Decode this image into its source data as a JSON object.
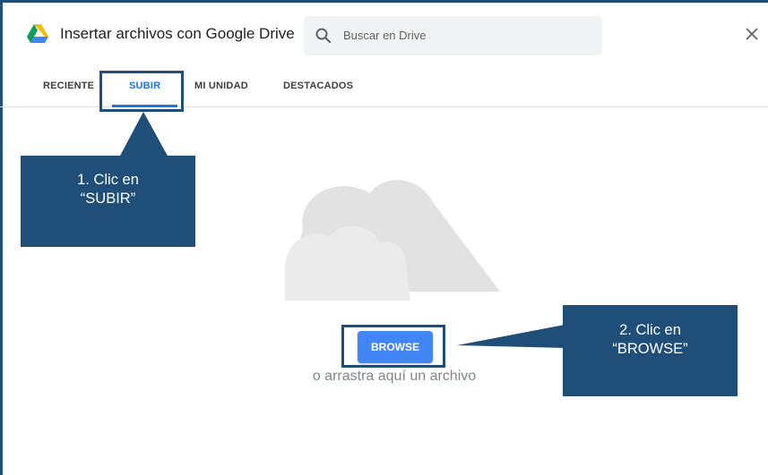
{
  "dialog": {
    "title": "Insertar archivos con Google Drive",
    "search_placeholder": "Buscar en Drive",
    "close_icon": "close-icon",
    "drive_icon": "google-drive-icon"
  },
  "tabs": [
    {
      "label": "RECIENTE",
      "active": false
    },
    {
      "label": "SUBIR",
      "active": true
    },
    {
      "label": "MI UNIDAD",
      "active": false
    },
    {
      "label": "DESTACADOS",
      "active": false
    }
  ],
  "upload": {
    "browse_label": "BROWSE",
    "drag_text": "o arrastra aquí un archivo",
    "illustration": "cloud-icon"
  },
  "annotations": {
    "step1": "1. Clic en\n“SUBIR”",
    "step2": "2. Clic en\n“BROWSE”"
  },
  "colors": {
    "annotation": "#1f4e79",
    "accent": "#1a73e8",
    "button": "#4285f4",
    "cloud": "#e2e2e3"
  }
}
